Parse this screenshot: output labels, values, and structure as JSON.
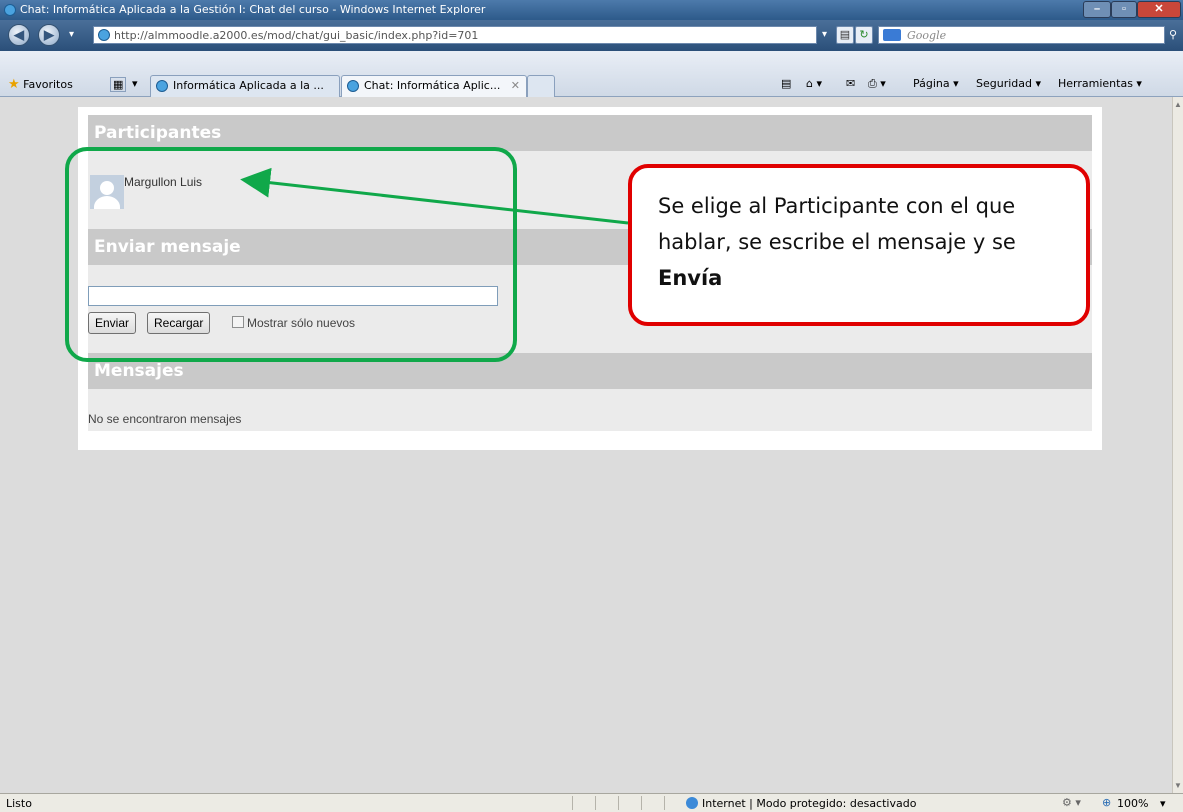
{
  "window": {
    "title": "Chat: Informática Aplicada a la Gestión I: Chat del curso - Windows Internet Explorer"
  },
  "address": {
    "url": "http://almmoodle.a2000.es/mod/chat/gui_basic/index.php?id=701",
    "search_placeholder": "Google"
  },
  "favorites": {
    "label": "Favoritos",
    "tabs": [
      {
        "label": "Informática Aplicada a la ..."
      },
      {
        "label": "Chat: Informática Aplic..."
      }
    ],
    "tools": {
      "page": "Página ▾",
      "security": "Seguridad ▾",
      "tools": "Herramientas ▾"
    }
  },
  "chat": {
    "participants_header": "Participantes",
    "participant_name": "Margullon Luis",
    "send_header": "Enviar mensaje",
    "message_value": "",
    "send_button": "Enviar",
    "reload_button": "Recargar",
    "only_new_label": "Mostrar sólo nuevos",
    "messages_header": "Mensajes",
    "no_messages": "No se encontraron mensajes"
  },
  "annotation": {
    "text": "Se elige al Participante con el que hablar, se escribe el mensaje y se",
    "bold": "Envía",
    "box_color": "#e00000",
    "highlight_color": "#10a84a"
  },
  "status": {
    "left": "Listo",
    "zone": "Internet | Modo protegido: desactivado",
    "zoom": "100%"
  }
}
